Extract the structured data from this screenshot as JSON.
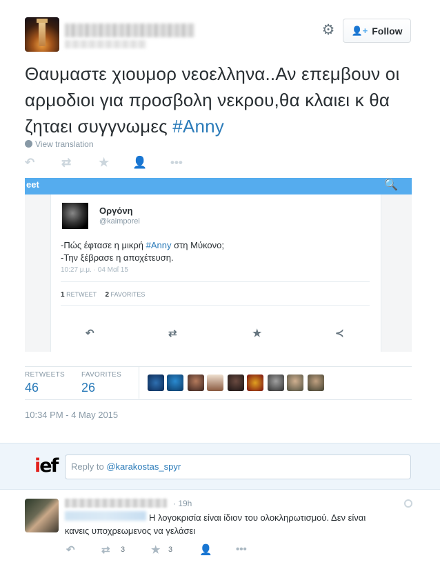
{
  "header": {
    "follow_label": "Follow"
  },
  "tweet": {
    "text_part1": "Θαυμαστε χιουμορ νεοελληνα..Αν επεμβουν οι αρμοδιοι για προσβολη νεκρου,θα κλαιει κ θα ζηταει συγγνωμες ",
    "hashtag": "#Anny",
    "view_translation": "View translation"
  },
  "embedded": {
    "bar_text": "eet",
    "card_name": "Οργόνη",
    "card_handle": "@kaimporei",
    "line1_pre": "-Πώς έφτασε η μικρή ",
    "line1_tag": "#Anny",
    "line1_post": " στη Μύκονο;",
    "line2": "-Την ξέβρασε η αποχέτευση.",
    "time": "10:27 μ.μ. · 04 Μαΐ 15",
    "retweet_count": "1",
    "retweet_label": "RETWEET",
    "favorite_count": "2",
    "favorite_label": "FAVORITES"
  },
  "stats": {
    "retweets_label": "RETWEETS",
    "retweets_value": "46",
    "favorites_label": "FAVORITES",
    "favorites_value": "26"
  },
  "timestamp": "10:34 PM - 4 May 2015",
  "reply_box": {
    "logo_red": "i",
    "logo_black": "ef",
    "prefix": "Reply to ",
    "mention": "@karakostas_spyr"
  },
  "reply": {
    "time": "· 19h",
    "line1": "Η λογοκρισία είναι ίδιον του ολοκληρωτισμού. Δεν είναι",
    "line2": "κανεις υποχρεωμενος να γελάσει",
    "retweets": "3",
    "favorites": "3"
  },
  "colors": {
    "accent": "#55acee",
    "link": "#2b7bb9"
  },
  "icons": [
    "gear-icon",
    "follow-person-icon",
    "globe-icon",
    "reply-icon",
    "retweet-icon",
    "favorite-icon",
    "follow-icon",
    "more-icon",
    "search-icon",
    "share-icon"
  ]
}
